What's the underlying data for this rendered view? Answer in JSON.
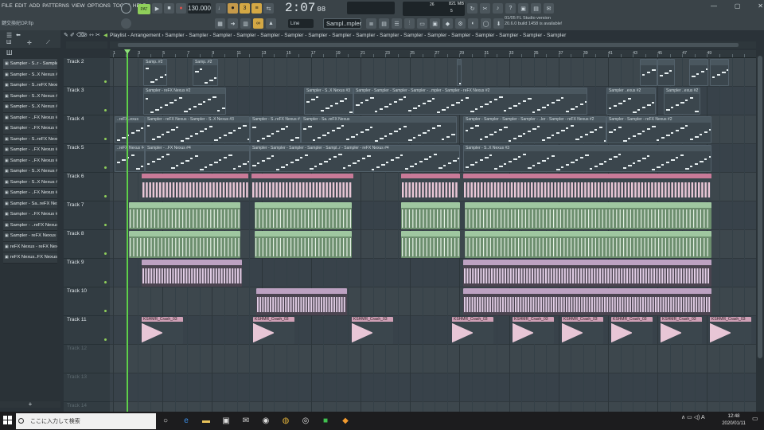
{
  "menu": [
    "FILE",
    "EDIT",
    "ADD",
    "PATTERNS",
    "VIEW",
    "OPTIONS",
    "TOOLS",
    "HELP"
  ],
  "file_title": "鍵交換紀OP.flp",
  "pattern_indicator": "PAT",
  "tempo": "130.000",
  "time": {
    "main": "2:07",
    "ms": "08"
  },
  "cpu": {
    "ram": "821 MB",
    "value1": "26",
    "value2": "5"
  },
  "snap_mode": "Line",
  "selected_sample": "Sampl..mpler",
  "hint": {
    "line1": "01/05  FL Studio version",
    "line2": "20.6.0 build 1458 is available!"
  },
  "playlist_title": "Playlist - Arrangement › Sampler - Sampler - Sampler - Sampler - Sampler - Sampler - Sampler - Sampler - Sampler - Sampler - Sampler - Sampler - Sampler - Sampler - Sampler - Sampler - Sampler",
  "browser": {
    "items": [
      "Sampler - S..r - Sampler",
      "Sampler - S..X Nexus #2",
      "Sampler - S..reFX Nexus",
      "Sampler - S..X Nexus #3",
      "Sampler - S..X Nexus #3",
      "Sampler - ..FX Nexus #2",
      "Sampler - ..FX Nexus #4",
      "Sampler - S..reFX Nexus",
      "Sampler - ..FX Nexus #2",
      "Sampler - ..FX Nexus #4",
      "Sampler - S..X Nexus #3",
      "Sampler - S..X Nexus #3",
      "Sampler - ..FX Nexus #2",
      "Sampler - Sa..reFX Nexus",
      "Sampler - ..FX Nexus #4",
      "Sampler - ..reFX Nexus #2",
      "Sampler - reFX Nexus #4",
      "reFX Nexus - reFX Nexus",
      "reFX Nexus..FX Nexus #4"
    ],
    "add_label": "+"
  },
  "ruler_numbers": [
    "1",
    "3",
    "5",
    "7",
    "9",
    "11",
    "13",
    "15",
    "17",
    "19",
    "21",
    "23",
    "25",
    "27",
    "29",
    "31",
    "33",
    "35",
    "37",
    "39",
    "41",
    "43",
    "45",
    "47",
    "49"
  ],
  "tracks": [
    "Track 2",
    "Track 3",
    "Track 4",
    "Track 5",
    "Track 6",
    "Track 7",
    "Track 8",
    "Track 9",
    "Track 10",
    "Track 11",
    "Track 12",
    "Track 13",
    "Track 14"
  ],
  "clips": {
    "t2": [
      "Samp..#2",
      "Samp..#2"
    ],
    "t3": [
      "Sampler - reFX Nexus #2",
      "Sampler - S..X Nexus #3",
      "Sampler - Sampler - Sampler - Sampler - ..mpler - Sampler - reFX Nexus #2",
      "Sampler ..exus #2",
      "Sampler ..exus #2"
    ],
    "t4": [
      "..reFX..exus",
      "Sampler - reFX Nexus - Sampler - S..X Nexus #3",
      "Sampler - S..reFX Nexus #2",
      "Sampler - Sa..reFX Nexus",
      "Sampler - Sampler - Sampler - Sampler - ..ler - Sampler - reFX Nexus #2",
      "Sampler - Sampler - reFX Nexus #2"
    ],
    "t5": [
      "..reFX Nexus #4",
      "Sampler - ..FX Nexus #4",
      "Sampler - Sampler - Sampler - Sampler - Sampl..r - Sampler - reFX Nexus #4",
      "Sampler - S..X Nexus #3"
    ],
    "crash": "KSHMR_Crash_03"
  },
  "taskbar": {
    "search_placeholder": "ここに入力して検索",
    "time": "12:48",
    "date": "2020/01/11",
    "ime": "A"
  },
  "colors": {
    "accent_green": "#8fcf5a",
    "audio_pink": "#c97a98",
    "green_clip": "#9fc7a0",
    "purple_clip": "#bda2c2"
  }
}
